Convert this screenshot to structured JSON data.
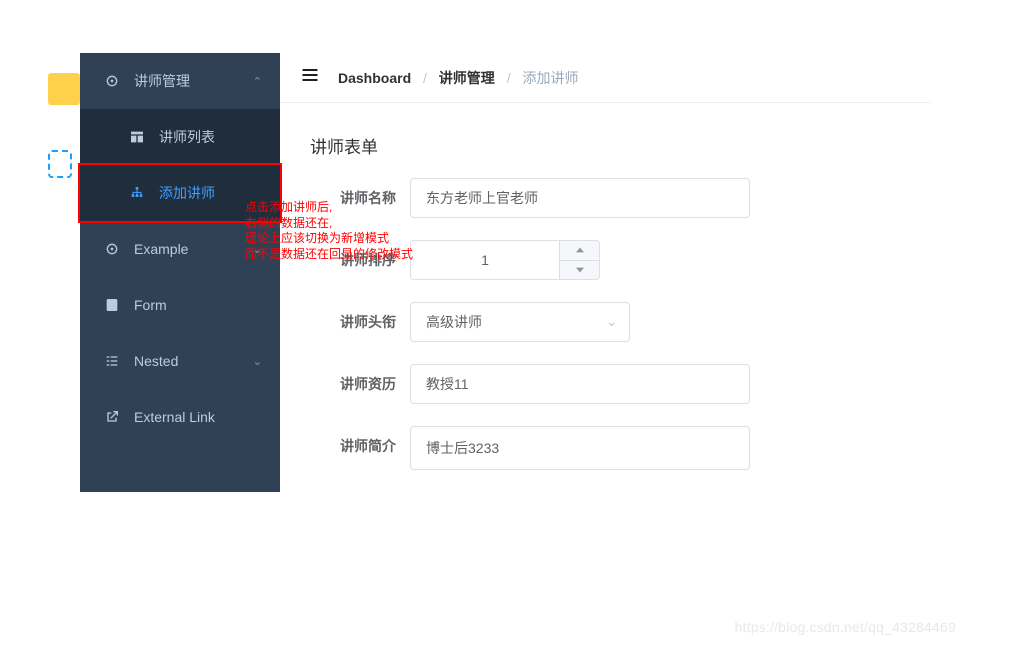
{
  "sidebar": {
    "group_label": "讲师管理",
    "items": [
      {
        "label": "讲师列表"
      },
      {
        "label": "添加讲师"
      }
    ],
    "other": [
      {
        "label": "Example"
      },
      {
        "label": "Form"
      },
      {
        "label": "Nested"
      },
      {
        "label": "External Link"
      }
    ]
  },
  "breadcrumb": {
    "root": "Dashboard",
    "mid": "讲师管理",
    "leaf": "添加讲师",
    "sep": "/"
  },
  "form": {
    "title": "讲师表单",
    "fields": {
      "name": {
        "label": "讲师名称",
        "value": "东方老师上官老师"
      },
      "sort": {
        "label": "讲师排序",
        "value": "1"
      },
      "title": {
        "label": "讲师头衔",
        "value": "高级讲师"
      },
      "career": {
        "label": "讲师资历",
        "value": "教授11"
      },
      "intro": {
        "label": "讲师简介",
        "value": "博士后3233"
      }
    }
  },
  "annotation": {
    "line1": "点击添加讲师后,",
    "line2": "右侧的数据还在,",
    "line3": "理论上应该切换为新增模式",
    "line4": "而不是数据还在回显的修改模式"
  },
  "watermark": "https://blog.csdn.net/qq_43284469"
}
